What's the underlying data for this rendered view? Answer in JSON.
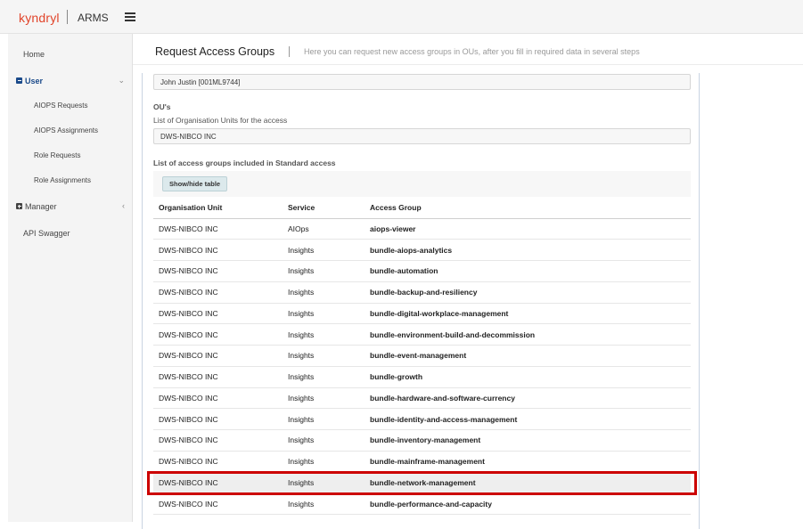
{
  "topbar": {
    "brand": "kyndryl",
    "app_name": "ARMS"
  },
  "sidebar": {
    "home": "Home",
    "user_group": "User",
    "user_items": [
      {
        "label": "AIOPS Requests"
      },
      {
        "label": "AIOPS Assignments"
      },
      {
        "label": "Role Requests"
      },
      {
        "label": "Role Assignments"
      }
    ],
    "manager_group": "Manager",
    "api_swagger": "API Swagger"
  },
  "header": {
    "title": "Request Access Groups",
    "subtitle": "Here you can request new access groups in OUs, after you fill in required data in several steps"
  },
  "form": {
    "user_value": "John Justin [001ML9744]",
    "ou_label": "OU's",
    "ou_hint": "List of Organisation Units for the access",
    "ou_value": "DWS-NIBCO INC",
    "access_label": "List of access groups included in Standard access",
    "toggle_label": "Show/hide table"
  },
  "table": {
    "headers": [
      "Organisation Unit",
      "Service",
      "Access Group"
    ],
    "rows": [
      [
        "DWS-NIBCO INC",
        "AIOps",
        "aiops-viewer"
      ],
      [
        "DWS-NIBCO INC",
        "Insights",
        "bundle-aiops-analytics"
      ],
      [
        "DWS-NIBCO INC",
        "Insights",
        "bundle-automation"
      ],
      [
        "DWS-NIBCO INC",
        "Insights",
        "bundle-backup-and-resiliency"
      ],
      [
        "DWS-NIBCO INC",
        "Insights",
        "bundle-digital-workplace-management"
      ],
      [
        "DWS-NIBCO INC",
        "Insights",
        "bundle-environment-build-and-decommission"
      ],
      [
        "DWS-NIBCO INC",
        "Insights",
        "bundle-event-management"
      ],
      [
        "DWS-NIBCO INC",
        "Insights",
        "bundle-growth"
      ],
      [
        "DWS-NIBCO INC",
        "Insights",
        "bundle-hardware-and-software-currency"
      ],
      [
        "DWS-NIBCO INC",
        "Insights",
        "bundle-identity-and-access-management"
      ],
      [
        "DWS-NIBCO INC",
        "Insights",
        "bundle-inventory-management"
      ],
      [
        "DWS-NIBCO INC",
        "Insights",
        "bundle-mainframe-management"
      ],
      [
        "DWS-NIBCO INC",
        "Insights",
        "bundle-network-management"
      ],
      [
        "DWS-NIBCO INC",
        "Insights",
        "bundle-performance-and-capacity"
      ]
    ]
  },
  "colors": {
    "brand": "#e1442a",
    "active_nav": "#1a4a8a",
    "highlight_border": "#cc0000"
  }
}
